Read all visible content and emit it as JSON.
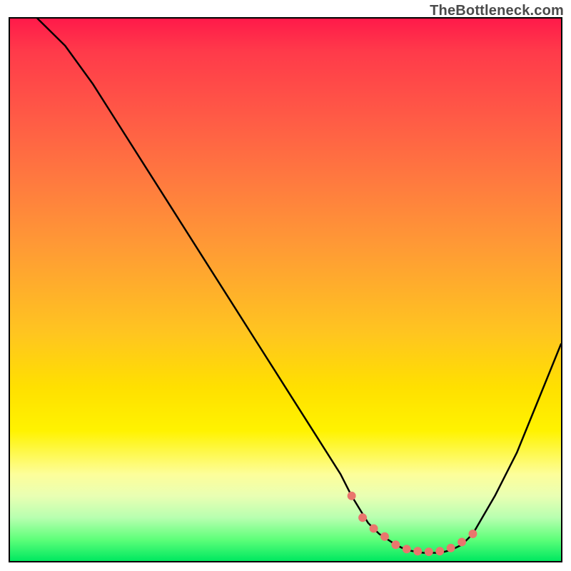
{
  "watermark": "TheBottleneck.com",
  "chart_data": {
    "type": "line",
    "title": "",
    "xlabel": "",
    "ylabel": "",
    "xlim": [
      0,
      100
    ],
    "ylim": [
      0,
      100
    ],
    "grid": false,
    "legend": false,
    "series": [
      {
        "name": "bottleneck-curve",
        "color": "#000000",
        "x": [
          5,
          10,
          15,
          20,
          25,
          30,
          35,
          40,
          45,
          50,
          55,
          60,
          62,
          65,
          67,
          70,
          72,
          75,
          78,
          80,
          82,
          84,
          88,
          92,
          96,
          100
        ],
        "y": [
          100,
          95,
          88,
          80,
          72,
          64,
          56,
          48,
          40,
          32,
          24,
          16,
          12,
          7,
          5,
          3,
          2,
          1.5,
          1.5,
          2,
          3,
          5,
          12,
          20,
          30,
          40
        ]
      }
    ],
    "markers": {
      "name": "bottom-dots",
      "color": "#e9766d",
      "radius_px": 6,
      "x": [
        62,
        64,
        66,
        68,
        70,
        72,
        74,
        76,
        78,
        80,
        82,
        84
      ],
      "y": [
        12,
        8,
        6,
        4.5,
        3,
        2.2,
        1.8,
        1.7,
        1.8,
        2.4,
        3.5,
        5
      ]
    },
    "gradient_stops": [
      {
        "pct": 0,
        "color": "#ff1a4a"
      },
      {
        "pct": 6,
        "color": "#ff3a4a"
      },
      {
        "pct": 18,
        "color": "#ff5a46"
      },
      {
        "pct": 30,
        "color": "#ff7a3f"
      },
      {
        "pct": 42,
        "color": "#ff9a35"
      },
      {
        "pct": 58,
        "color": "#ffc520"
      },
      {
        "pct": 68,
        "color": "#ffe000"
      },
      {
        "pct": 76,
        "color": "#fff300"
      },
      {
        "pct": 84,
        "color": "#fdfe9a"
      },
      {
        "pct": 88,
        "color": "#e9ffb3"
      },
      {
        "pct": 92,
        "color": "#b8ffb0"
      },
      {
        "pct": 96,
        "color": "#5fff7a"
      },
      {
        "pct": 100,
        "color": "#00e860"
      }
    ]
  }
}
